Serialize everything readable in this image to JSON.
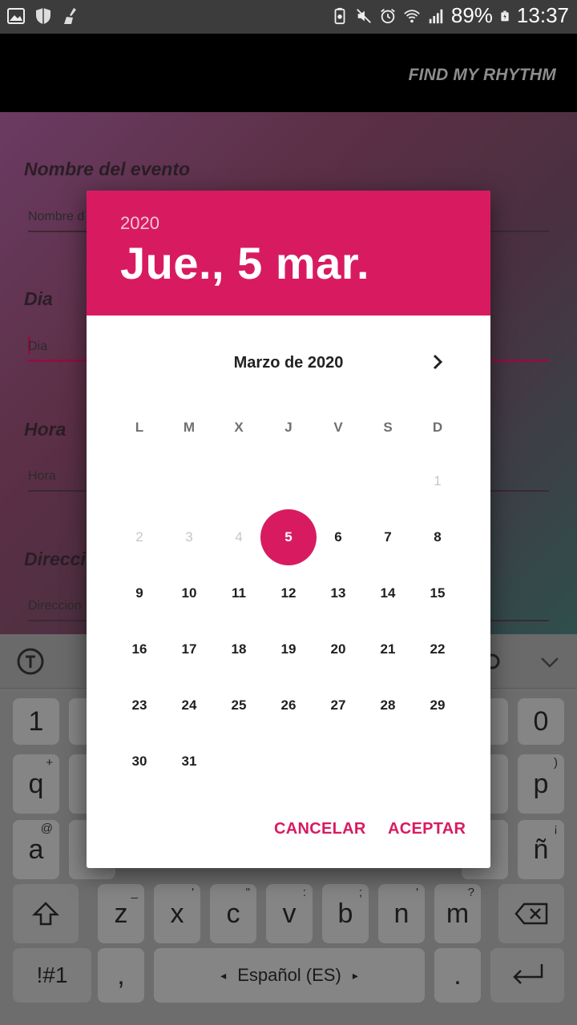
{
  "status_bar": {
    "battery": "89%",
    "time": "13:37",
    "icons_left": [
      "gallery-icon",
      "shield-icon",
      "broom-icon"
    ],
    "icons_right": [
      "battery-saver-icon",
      "mute-icon",
      "alarm-icon",
      "wifi-icon",
      "signal-icon",
      "battery-icon"
    ]
  },
  "app_bar": {
    "title": "FIND MY RHYTHM"
  },
  "form": {
    "event_name": {
      "label": "Nombre del evento",
      "placeholder": "Nombre d"
    },
    "day": {
      "label": "Dia",
      "placeholder": "Dia"
    },
    "time": {
      "label": "Hora",
      "placeholder": "Hora"
    },
    "address": {
      "label": "Direcci",
      "placeholder": "Direccion"
    }
  },
  "dialog": {
    "year": "2020",
    "selected_date": "Jue., 5 mar.",
    "month_label": "Marzo de 2020",
    "weekdays": [
      "L",
      "M",
      "X",
      "J",
      "V",
      "S",
      "D"
    ],
    "days": [
      {
        "d": "1",
        "state": "disabled"
      },
      {
        "d": "2",
        "state": "disabled"
      },
      {
        "d": "3",
        "state": "disabled"
      },
      {
        "d": "4",
        "state": "disabled"
      },
      {
        "d": "5",
        "state": "selected"
      },
      {
        "d": "6",
        "state": "enabled"
      },
      {
        "d": "7",
        "state": "enabled"
      },
      {
        "d": "8",
        "state": "enabled"
      },
      {
        "d": "9",
        "state": "enabled"
      },
      {
        "d": "10",
        "state": "enabled"
      },
      {
        "d": "11",
        "state": "enabled"
      },
      {
        "d": "12",
        "state": "enabled"
      },
      {
        "d": "13",
        "state": "enabled"
      },
      {
        "d": "14",
        "state": "enabled"
      },
      {
        "d": "15",
        "state": "enabled"
      },
      {
        "d": "16",
        "state": "enabled"
      },
      {
        "d": "17",
        "state": "enabled"
      },
      {
        "d": "18",
        "state": "enabled"
      },
      {
        "d": "19",
        "state": "enabled"
      },
      {
        "d": "20",
        "state": "enabled"
      },
      {
        "d": "21",
        "state": "enabled"
      },
      {
        "d": "22",
        "state": "enabled"
      },
      {
        "d": "23",
        "state": "enabled"
      },
      {
        "d": "24",
        "state": "enabled"
      },
      {
        "d": "25",
        "state": "enabled"
      },
      {
        "d": "26",
        "state": "enabled"
      },
      {
        "d": "27",
        "state": "enabled"
      },
      {
        "d": "28",
        "state": "enabled"
      },
      {
        "d": "29",
        "state": "enabled"
      },
      {
        "d": "30",
        "state": "enabled"
      },
      {
        "d": "31",
        "state": "enabled"
      }
    ],
    "cancel_label": "CANCELAR",
    "accept_label": "ACEPTAR",
    "accent_color": "#d81b60"
  },
  "keyboard": {
    "row_numbers": [
      "1",
      "0"
    ],
    "row1": [
      {
        "k": "q",
        "sup": "+"
      },
      {
        "k": "p",
        "sup": ")"
      }
    ],
    "row2": [
      {
        "k": "a",
        "sup": "@"
      },
      {
        "k": "ñ",
        "sup": "¡"
      }
    ],
    "row3": [
      {
        "k": "z",
        "sup": "_"
      },
      {
        "k": "x",
        "sup": "'"
      },
      {
        "k": "c",
        "sup": "\""
      },
      {
        "k": "v",
        "sup": ":"
      },
      {
        "k": "b",
        "sup": ";"
      },
      {
        "k": "n",
        "sup": "'"
      },
      {
        "k": "m",
        "sup": "?"
      }
    ],
    "symbols_label": "!#1",
    "comma": ",",
    "space_label": "Español (ES)",
    "period": "."
  }
}
